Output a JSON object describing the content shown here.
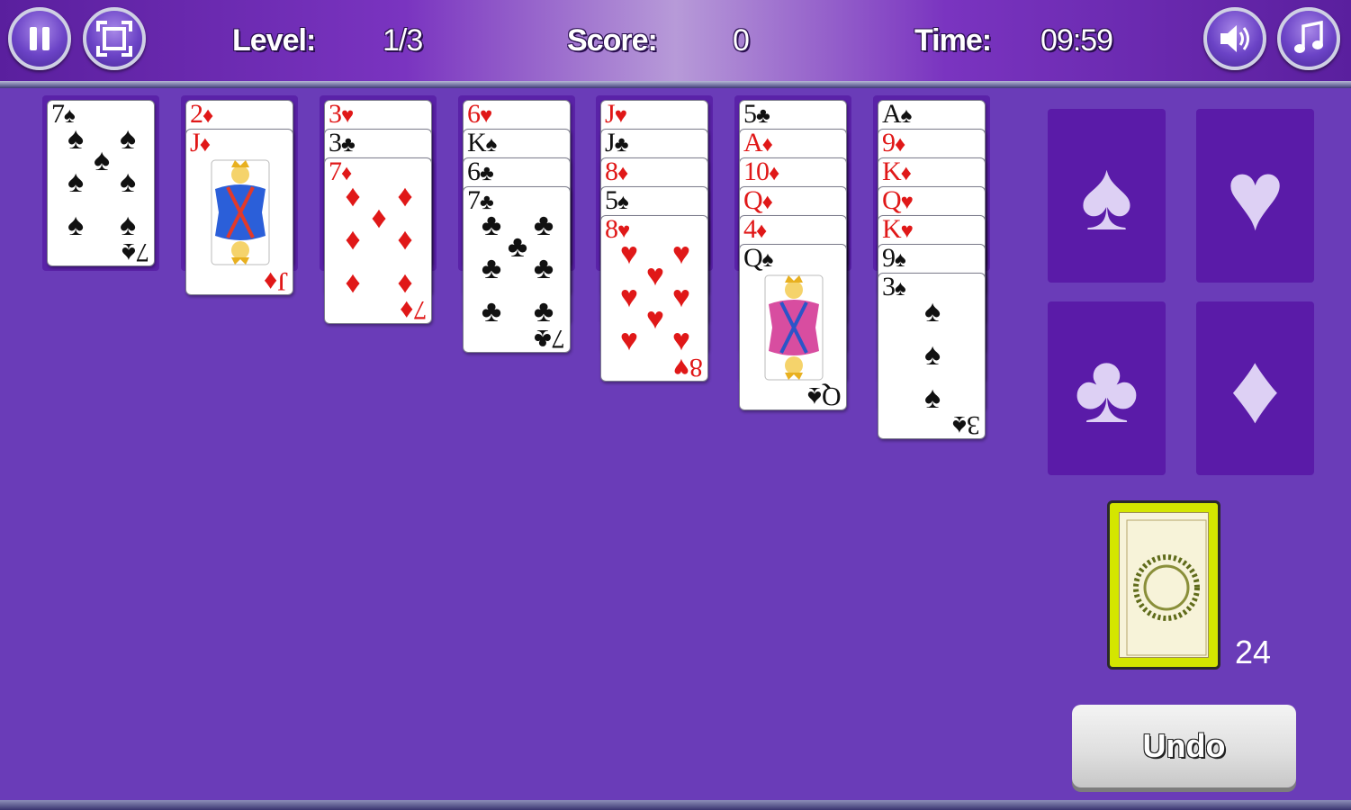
{
  "header": {
    "level_label": "Level:",
    "level_value": "1/3",
    "score_label": "Score:",
    "score_value": "0",
    "time_label": "Time:",
    "time_value": "09:59"
  },
  "buttons": {
    "pause_icon": "pause-icon",
    "fullscreen_icon": "fullscreen-icon",
    "sound_icon": "speaker-icon",
    "music_icon": "music-note-icon",
    "undo_label": "Undo"
  },
  "tableau": [
    {
      "cards": [
        {
          "rank": "7",
          "suit": "♠",
          "color": "black"
        }
      ]
    },
    {
      "cards": [
        {
          "rank": "2",
          "suit": "♦",
          "color": "red"
        },
        {
          "rank": "J",
          "suit": "♦",
          "color": "red"
        }
      ]
    },
    {
      "cards": [
        {
          "rank": "3",
          "suit": "♥",
          "color": "red"
        },
        {
          "rank": "3",
          "suit": "♣",
          "color": "black"
        },
        {
          "rank": "7",
          "suit": "♦",
          "color": "red"
        }
      ]
    },
    {
      "cards": [
        {
          "rank": "6",
          "suit": "♥",
          "color": "red"
        },
        {
          "rank": "K",
          "suit": "♠",
          "color": "black"
        },
        {
          "rank": "6",
          "suit": "♣",
          "color": "black"
        },
        {
          "rank": "7",
          "suit": "♣",
          "color": "black"
        }
      ]
    },
    {
      "cards": [
        {
          "rank": "J",
          "suit": "♥",
          "color": "red"
        },
        {
          "rank": "J",
          "suit": "♣",
          "color": "black"
        },
        {
          "rank": "8",
          "suit": "♦",
          "color": "red"
        },
        {
          "rank": "5",
          "suit": "♠",
          "color": "black"
        },
        {
          "rank": "8",
          "suit": "♥",
          "color": "red"
        }
      ]
    },
    {
      "cards": [
        {
          "rank": "5",
          "suit": "♣",
          "color": "black"
        },
        {
          "rank": "A",
          "suit": "♦",
          "color": "red"
        },
        {
          "rank": "10",
          "suit": "♦",
          "color": "red"
        },
        {
          "rank": "Q",
          "suit": "♦",
          "color": "red"
        },
        {
          "rank": "4",
          "suit": "♦",
          "color": "red"
        },
        {
          "rank": "Q",
          "suit": "♠",
          "color": "black"
        }
      ]
    },
    {
      "cards": [
        {
          "rank": "A",
          "suit": "♠",
          "color": "black"
        },
        {
          "rank": "9",
          "suit": "♦",
          "color": "red"
        },
        {
          "rank": "K",
          "suit": "♦",
          "color": "red"
        },
        {
          "rank": "Q",
          "suit": "♥",
          "color": "red"
        },
        {
          "rank": "K",
          "suit": "♥",
          "color": "red"
        },
        {
          "rank": "9",
          "suit": "♠",
          "color": "black"
        },
        {
          "rank": "3",
          "suit": "♠",
          "color": "black"
        }
      ]
    }
  ],
  "foundations": [
    {
      "suit": "♠",
      "name": "spade"
    },
    {
      "suit": "♥",
      "name": "heart"
    },
    {
      "suit": "♣",
      "name": "club"
    },
    {
      "suit": "♦",
      "name": "diamond"
    }
  ],
  "stock": {
    "count": "24"
  },
  "colors": {
    "table": "#6a3cb8",
    "foundation": "#5a1ba8",
    "red_suit": "#e01818",
    "stock_back": "#d4e600"
  }
}
